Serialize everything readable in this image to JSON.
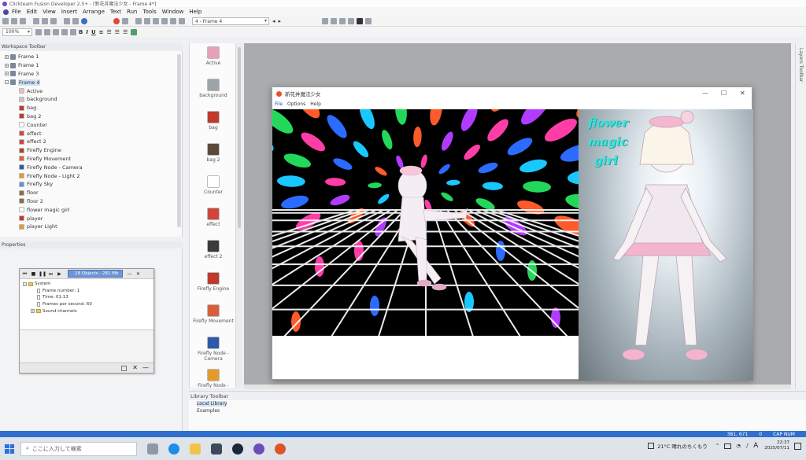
{
  "window": {
    "title": "Clickteam Fusion Developer 2.5+ - [新花丼魔法少女 - Frame 4*]"
  },
  "menu": [
    "File",
    "Edit",
    "View",
    "Insert",
    "Arrange",
    "Text",
    "Run",
    "Tools",
    "Window",
    "Help"
  ],
  "toolbar": {
    "zoom": "100%",
    "frame_select": "4 - Frame 4"
  },
  "workspace": {
    "title": "Workspace Toolbar",
    "frames": [
      "Frame 1",
      "Frame 1",
      "Frame 3",
      "Frame 4"
    ],
    "objects": [
      "Active",
      "background",
      "bag",
      "bag 2",
      "Counter",
      "effect",
      "effect 2",
      "Firefly Engine",
      "Firefly Movement",
      "Firefly Node - Camera",
      "Firefly Node - Light 2",
      "Firefly Sky",
      "floor",
      "floor 2",
      "flower magic girl",
      "player",
      "player Light"
    ]
  },
  "properties": {
    "title": "Properties"
  },
  "debugger": {
    "selector": "18 Objects - 281 Mb",
    "root": "System",
    "lines": [
      "Frame number: 1",
      "Time: 01:13",
      "Frames per second: 60"
    ],
    "folder": "Sound channels"
  },
  "object_toolbar": [
    {
      "label": "Active",
      "color": "#e7a0b8"
    },
    {
      "label": "background",
      "color": "#9ea3a8"
    },
    {
      "label": "bag",
      "color": "#c0392b"
    },
    {
      "label": "bag 2",
      "color": "#5b4a3a"
    },
    {
      "label": "Counter",
      "color": "#ffffff"
    },
    {
      "label": "effect",
      "color": "#d1463a"
    },
    {
      "label": "effect 2",
      "color": "#3a3a3a"
    },
    {
      "label": "Firefly Engine",
      "color": "#c0392b"
    },
    {
      "label": "Firefly Movement",
      "color": "#d95f3a"
    },
    {
      "label": "Firefly Node - Camera",
      "color": "#2d5aa8"
    },
    {
      "label": "Firefly Node -",
      "color": "#e39b2e"
    }
  ],
  "game_window": {
    "title": "新花丼魔法少女",
    "menu": [
      "File",
      "Options",
      "Help"
    ],
    "side_title_lines": [
      "flower",
      "magic",
      "girl"
    ]
  },
  "library": {
    "title": "Library Toolbar",
    "items": [
      "Local Library",
      "Examples"
    ]
  },
  "layers": {
    "title": "Layers Toolbar"
  },
  "statusbar": {
    "coords": "381, 671",
    "count": "0",
    "mode": "CAP NUM"
  },
  "taskbar": {
    "search_placeholder": "ここに入力して検索",
    "weather": "21°C 晴れのちくもり",
    "time": "22:37",
    "date": "2025/07/11",
    "ime": "A"
  }
}
